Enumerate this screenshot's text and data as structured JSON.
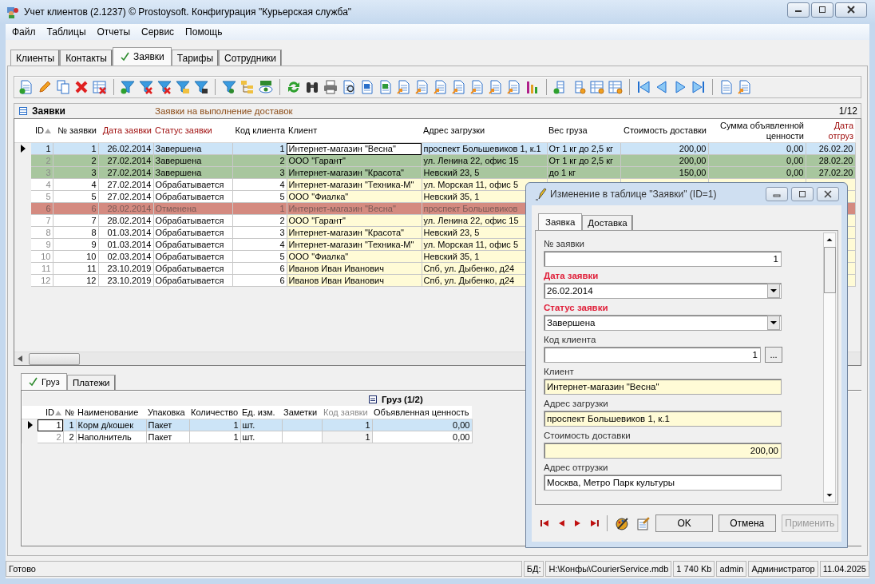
{
  "window": {
    "title": "Учет клиентов (2.1237) © Prostoysoft. Конфигурация \"Курьерская служба\""
  },
  "menu": [
    "Файл",
    "Таблицы",
    "Отчеты",
    "Сервис",
    "Помощь"
  ],
  "tabs": [
    {
      "label": "Клиенты",
      "selected": false,
      "checked": false
    },
    {
      "label": "Контакты",
      "selected": false,
      "checked": false
    },
    {
      "label": "Заявки",
      "selected": true,
      "checked": true
    },
    {
      "label": "Тарифы",
      "selected": false,
      "checked": false
    },
    {
      "label": "Сотрудники",
      "selected": false,
      "checked": false
    }
  ],
  "table_panel": {
    "title": "Заявки",
    "description": "Заявки на выполнение доставок",
    "position": "1/12"
  },
  "table": {
    "columns": [
      {
        "label": "ID",
        "required": false,
        "sorted": true
      },
      {
        "label": "№ заявки",
        "required": false,
        "sorted": false
      },
      {
        "label": "Дата заявки",
        "required": true,
        "sorted": false
      },
      {
        "label": "Статус заявки",
        "required": true,
        "sorted": false
      },
      {
        "label": "Код клиента",
        "required": false,
        "sorted": false
      },
      {
        "label": "Клиент",
        "required": false,
        "sorted": false
      },
      {
        "label": "Адрес загрузки",
        "required": false,
        "sorted": false
      },
      {
        "label": "Вес груза",
        "required": false,
        "sorted": false
      },
      {
        "label": "Стоимость доставки",
        "required": false,
        "sorted": false
      },
      {
        "label": "Сумма объявленной ценности",
        "required": false,
        "sorted": false
      },
      {
        "label": "Дата отгруз",
        "required": true,
        "sorted": false
      }
    ],
    "rows": [
      {
        "selected": true,
        "kind": "normal",
        "cells": [
          "1",
          "1",
          "26.02.2014",
          "Завершена",
          "1",
          "Интернет-магазин \"Весна\"",
          "проспект Большевиков 1, к.1",
          "От 1 кг до 2,5 кг",
          "200,00",
          "0,00",
          "26.02.20"
        ]
      },
      {
        "selected": false,
        "kind": "done",
        "cells": [
          "2",
          "2",
          "27.02.2014",
          "Завершена",
          "2",
          "ООО \"Гарант\"",
          "ул. Ленина 22, офис 15",
          "От 1 кг до 2,5 кг",
          "200,00",
          "0,00",
          "28.02.20"
        ]
      },
      {
        "selected": false,
        "kind": "done",
        "cells": [
          "3",
          "3",
          "27.02.2014",
          "Завершена",
          "3",
          "Интернет-магазин \"Красота\"",
          "Невский 23, 5",
          "до 1 кг",
          "150,00",
          "0,00",
          "27.02.20"
        ]
      },
      {
        "selected": false,
        "kind": "normal",
        "cells": [
          "4",
          "4",
          "27.02.2014",
          "Обрабатывается",
          "4",
          "Интернет-магазин \"Техника-М\"",
          "ул. Морская 11, офис 5"
        ]
      },
      {
        "selected": false,
        "kind": "normal",
        "cells": [
          "5",
          "5",
          "27.02.2014",
          "Обрабатывается",
          "5",
          "ООО \"Фиалка\"",
          "Невский 35, 1"
        ]
      },
      {
        "selected": false,
        "kind": "cancelled",
        "cells": [
          "6",
          "6",
          "28.02.2014",
          "Отменена",
          "1",
          "Интернет-магазин \"Весна\"",
          "проспект Большевиков"
        ]
      },
      {
        "selected": false,
        "kind": "normal",
        "cells": [
          "7",
          "7",
          "28.02.2014",
          "Обрабатывается",
          "2",
          "ООО \"Гарант\"",
          "ул. Ленина 22, офис 15"
        ]
      },
      {
        "selected": false,
        "kind": "normal",
        "cells": [
          "8",
          "8",
          "01.03.2014",
          "Обрабатывается",
          "3",
          "Интернет-магазин \"Красота\"",
          "Невский 23, 5"
        ]
      },
      {
        "selected": false,
        "kind": "normal",
        "cells": [
          "9",
          "9",
          "01.03.2014",
          "Обрабатывается",
          "4",
          "Интернет-магазин \"Техника-М\"",
          "ул. Морская 11, офис 5"
        ]
      },
      {
        "selected": false,
        "kind": "normal",
        "cells": [
          "10",
          "10",
          "02.03.2014",
          "Обрабатывается",
          "5",
          "ООО \"Фиалка\"",
          "Невский 35, 1"
        ]
      },
      {
        "selected": false,
        "kind": "normal",
        "cells": [
          "11",
          "11",
          "23.10.2019",
          "Обрабатывается",
          "6",
          "Иванов Иван Иванович",
          "Спб, ул. Дыбенко, д24"
        ]
      },
      {
        "selected": false,
        "kind": "normal",
        "cells": [
          "12",
          "12",
          "23.10.2019",
          "Обрабатывается",
          "6",
          "Иванов Иван Иванович",
          "Спб, ул. Дыбенко, д24"
        ]
      }
    ]
  },
  "detail_tabs": [
    {
      "label": "Груз",
      "selected": true,
      "checked": true
    },
    {
      "label": "Платежи",
      "selected": false,
      "checked": false
    }
  ],
  "detail_table": {
    "title": "Груз (1/2)",
    "columns": [
      {
        "label": "ID",
        "sorted": true,
        "disabled": false
      },
      {
        "label": "№",
        "sorted": false,
        "disabled": false
      },
      {
        "label": "Наименование",
        "sorted": false,
        "disabled": false
      },
      {
        "label": "Упаковка",
        "sorted": false,
        "disabled": false
      },
      {
        "label": "Количество",
        "sorted": false,
        "disabled": false
      },
      {
        "label": "Ед. изм.",
        "sorted": false,
        "disabled": false
      },
      {
        "label": "Заметки",
        "sorted": false,
        "disabled": false
      },
      {
        "label": "Код заявки",
        "sorted": false,
        "disabled": true
      },
      {
        "label": "Объявленная ценность",
        "sorted": false,
        "disabled": false
      }
    ],
    "rows": [
      {
        "selected": true,
        "cells": [
          "1",
          "1",
          "Корм д/кошек",
          "Пакет",
          "1",
          "шт.",
          null,
          "1",
          "0,00"
        ]
      },
      {
        "selected": false,
        "cells": [
          "2",
          "2",
          "Наполнитель",
          "Пакет",
          "1",
          "шт.",
          null,
          "1",
          "0,00"
        ]
      }
    ]
  },
  "dialog": {
    "title": "Изменение в таблице \"Заявки\" (ID=1)",
    "tabs": [
      {
        "label": "Заявка",
        "selected": true
      },
      {
        "label": "Доставка",
        "selected": false
      }
    ],
    "fields": [
      {
        "label": "№ заявки",
        "value": "1",
        "kind": "number",
        "required": false
      },
      {
        "label": "Дата заявки",
        "value": "26.02.2014",
        "kind": "combo",
        "required": true
      },
      {
        "label": "Статус заявки",
        "value": "Завершена",
        "kind": "combo",
        "required": true
      },
      {
        "label": "Код клиента",
        "value": "1",
        "kind": "picker",
        "button": "...",
        "required": false
      },
      {
        "label": "Клиент",
        "value": "Интернет-магазин \"Весна\"",
        "kind": "lookup",
        "required": false
      },
      {
        "label": "Адрес загрузки",
        "value": "проспект Большевиков 1, к.1",
        "kind": "lookup",
        "required": false
      },
      {
        "label": "Стоимость доставки",
        "value": "200,00",
        "kind": "money",
        "required": false
      },
      {
        "label": "Адрес отгрузки",
        "value": "Москва, Метро Парк культуры",
        "kind": "text",
        "required": false
      }
    ],
    "buttons": [
      {
        "label": "OK",
        "disabled": false
      },
      {
        "label": "Отмена",
        "disabled": false
      },
      {
        "label": "Применить",
        "disabled": true
      }
    ]
  },
  "status_bar": {
    "message": "Готово",
    "panels": [
      "БД:",
      "H:\\Конфы\\CourierService.mdb",
      "1 740 Kb",
      "admin",
      "Администратор",
      "11.04.2025"
    ]
  }
}
